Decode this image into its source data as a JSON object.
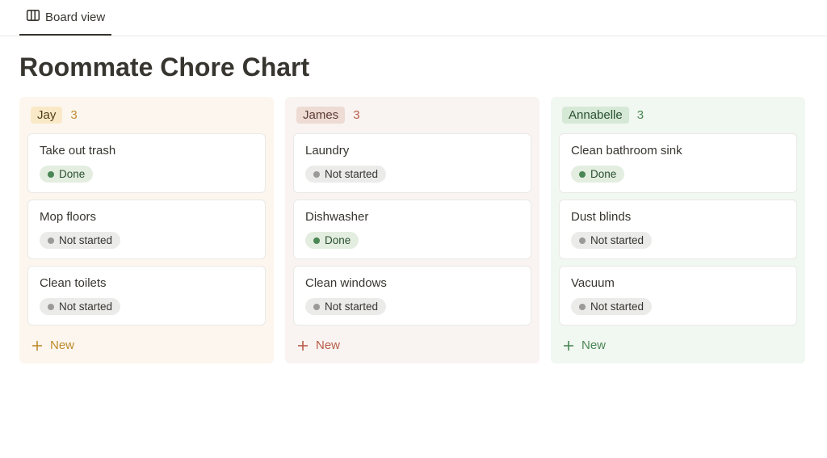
{
  "tab": {
    "label": "Board view"
  },
  "page": {
    "title": "Roommate Chore Chart"
  },
  "columns": [
    {
      "name": "Jay",
      "count": "3",
      "cards": [
        {
          "title": "Take out trash",
          "status": "Done",
          "statusType": "done"
        },
        {
          "title": "Mop floors",
          "status": "Not started",
          "statusType": "notstarted"
        },
        {
          "title": "Clean toilets",
          "status": "Not started",
          "statusType": "notstarted"
        }
      ],
      "newLabel": "New"
    },
    {
      "name": "James",
      "count": "3",
      "cards": [
        {
          "title": "Laundry",
          "status": "Not started",
          "statusType": "notstarted"
        },
        {
          "title": "Dishwasher",
          "status": "Done",
          "statusType": "done"
        },
        {
          "title": "Clean windows",
          "status": "Not started",
          "statusType": "notstarted"
        }
      ],
      "newLabel": "New"
    },
    {
      "name": "Annabelle",
      "count": "3",
      "cards": [
        {
          "title": "Clean bathroom sink",
          "status": "Done",
          "statusType": "done"
        },
        {
          "title": "Dust blinds",
          "status": "Not started",
          "statusType": "notstarted"
        },
        {
          "title": "Vacuum",
          "status": "Not started",
          "statusType": "notstarted"
        }
      ],
      "newLabel": "New"
    }
  ]
}
